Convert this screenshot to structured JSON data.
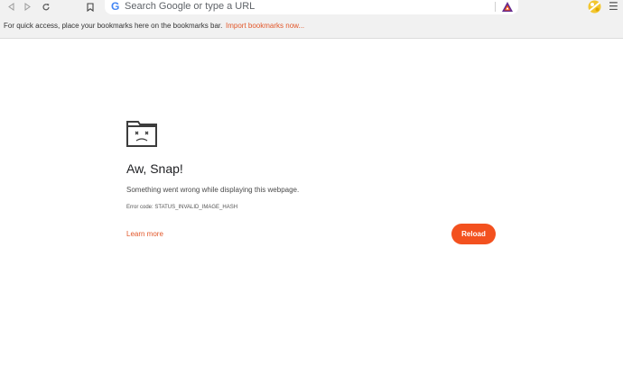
{
  "toolbar": {
    "back_icon": "triangle-left-icon",
    "forward_icon": "triangle-right-icon",
    "reload_icon": "reload-icon",
    "bookmark_icon": "bookmark-icon",
    "extension_icon": "brave-rewards-icon",
    "profile_icon": "profile-avatar-icon",
    "menu_icon": "hamburger-menu-icon"
  },
  "omnibox": {
    "engine_icon": "google-g-icon",
    "placeholder": "Search Google or type a URL",
    "value": ""
  },
  "bookmarks_bar": {
    "hint": "For quick access, place your bookmarks here on the bookmarks bar.",
    "import_link": "Import bookmarks now..."
  },
  "error_page": {
    "icon": "sad-folder-icon",
    "title": "Aw, Snap!",
    "message": "Something went wrong while displaying this webpage.",
    "error_code": "Error code: STATUS_INVALID_IMAGE_HASH",
    "learn_more": "Learn more",
    "reload_label": "Reload"
  },
  "colors": {
    "accent": "#f3511f",
    "link": "#e2572a",
    "toolbar_bg": "#f1f1f1"
  }
}
